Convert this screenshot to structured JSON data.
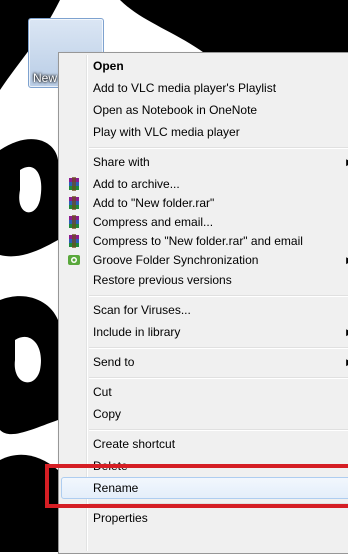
{
  "desktop": {
    "icon_label": "New"
  },
  "menu": {
    "items": [
      {
        "label": "Open",
        "bold": true
      },
      {
        "label": "Add to VLC media player's Playlist"
      },
      {
        "label": "Open as Notebook in OneNote"
      },
      {
        "label": "Play with VLC media player"
      },
      {
        "label": "Share with",
        "submenu": true
      },
      {
        "label": "Add to archive...",
        "icon": "winrar-icon"
      },
      {
        "label": "Add to \"New folder.rar\"",
        "icon": "winrar-icon"
      },
      {
        "label": "Compress and email...",
        "icon": "winrar-icon"
      },
      {
        "label": "Compress to \"New folder.rar\" and email",
        "icon": "winrar-icon"
      },
      {
        "label": "Groove Folder Synchronization",
        "icon": "groove-icon",
        "submenu": true
      },
      {
        "label": "Restore previous versions"
      },
      {
        "label": "Scan for Viruses..."
      },
      {
        "label": "Include in library",
        "submenu": true
      },
      {
        "label": "Send to",
        "submenu": true
      },
      {
        "label": "Cut"
      },
      {
        "label": "Copy"
      },
      {
        "label": "Create shortcut"
      },
      {
        "label": "Delete"
      },
      {
        "label": "Rename",
        "hover": true
      },
      {
        "label": "Properties"
      }
    ]
  },
  "colors": {
    "highlight_border": "#d51e24",
    "menu_background": "#f0f0f0"
  }
}
